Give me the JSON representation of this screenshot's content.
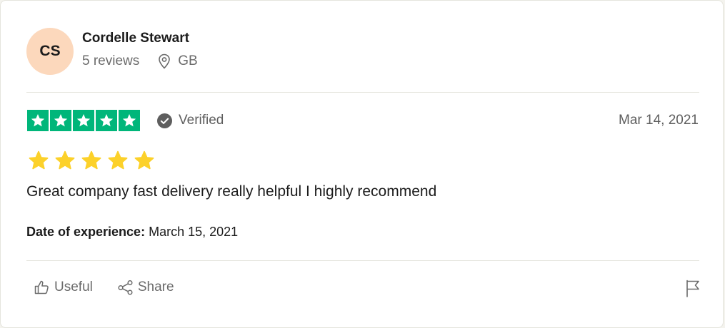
{
  "review": {
    "consumer": {
      "initials": "CS",
      "name": "Cordelle Stewart",
      "reviews_count": "5 reviews",
      "country": "GB",
      "avatar_color": "#fcd8bc"
    },
    "rating": 5,
    "rating_color": "#00b67a",
    "verified_label": "Verified",
    "date": "Mar 14, 2021",
    "secondary_rating": 5,
    "secondary_star_color": "#fcd12a",
    "text": "Great company fast delivery really helpful I highly recommend",
    "experience_label": "Date of experience:",
    "experience_date": "March 15, 2021"
  },
  "actions": {
    "useful_label": "Useful",
    "share_label": "Share"
  },
  "icons": {
    "location": "location-pin-icon",
    "verified": "verified-check-icon",
    "useful": "thumbs-up-icon",
    "share": "share-icon",
    "flag": "flag-icon"
  }
}
